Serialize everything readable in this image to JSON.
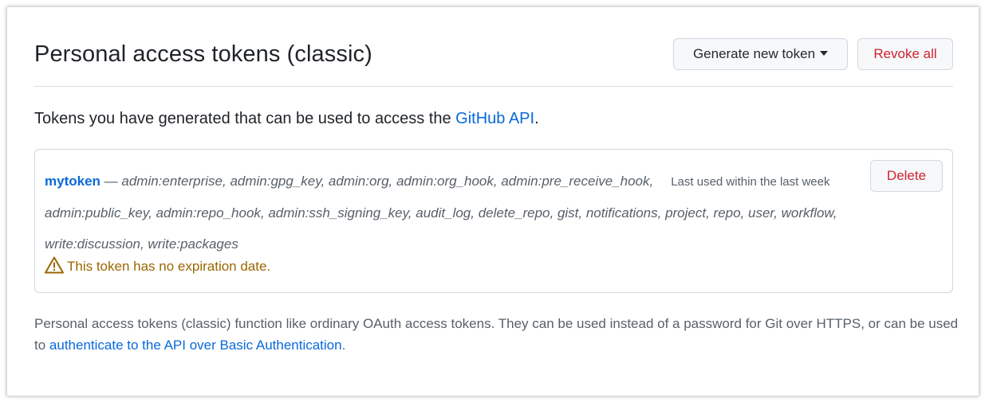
{
  "header": {
    "title": "Personal access tokens (classic)",
    "generate_label": "Generate new token",
    "revoke_label": "Revoke all"
  },
  "intro": {
    "text": "Tokens you have generated that can be used to access the ",
    "link": "GitHub API",
    "suffix": "."
  },
  "token": {
    "name": "mytoken",
    "separator": " — ",
    "scopes": "admin:enterprise, admin:gpg_key, admin:org, admin:org_hook, admin:pre_receive_hook, admin:public_key, admin:repo_hook, admin:ssh_signing_key, audit_log, delete_repo, gist, notifications, project, repo, user, workflow, write:discussion, write:packages",
    "last_used": "Last used within the last week",
    "delete_label": "Delete",
    "warning": "This token has no expiration date.",
    "warning_icon": "alert-triangle-icon"
  },
  "footer": {
    "text": "Personal access tokens (classic) function like ordinary OAuth access tokens. They can be used instead of a password for Git over HTTPS, or can be used to ",
    "link": "authenticate to the API over Basic Authentication",
    "suffix": "."
  },
  "colors": {
    "link": "#0969da",
    "danger": "#cf222e",
    "warning": "#9a6700",
    "muted": "#57606a"
  }
}
